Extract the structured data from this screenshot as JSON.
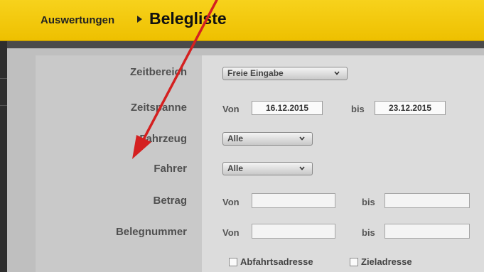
{
  "header": {
    "breadcrumb_root": "Auswertungen",
    "title": "Belegliste"
  },
  "form": {
    "zeitbereich": {
      "label": "Zeitbereich",
      "value": "Freie Eingabe"
    },
    "zeitspanne": {
      "label": "Zeitspanne",
      "von_label": "Von",
      "von_value": "16.12.2015",
      "bis_label": "bis",
      "bis_value": "23.12.2015"
    },
    "fahrzeug": {
      "label": "Fahrzeug",
      "value": "Alle"
    },
    "fahrer": {
      "label": "Fahrer",
      "value": "Alle"
    },
    "betrag": {
      "label": "Betrag",
      "von_label": "Von",
      "von_value": "",
      "bis_label": "bis",
      "bis_value": ""
    },
    "belegnummer": {
      "label": "Belegnummer",
      "von_label": "Von",
      "von_value": "",
      "bis_label": "bis",
      "bis_value": ""
    },
    "checkboxes": [
      {
        "label": "Abfahrtsadresse",
        "checked": false
      },
      {
        "label": "Zieladresse",
        "checked": false
      }
    ]
  },
  "colors": {
    "header_yellow": "#f2c80a",
    "annotation_arrow": "#d42020"
  },
  "icons": {
    "breadcrumb_separator": "triangle-right-icon",
    "dropdown": "chevron-down-icon"
  }
}
